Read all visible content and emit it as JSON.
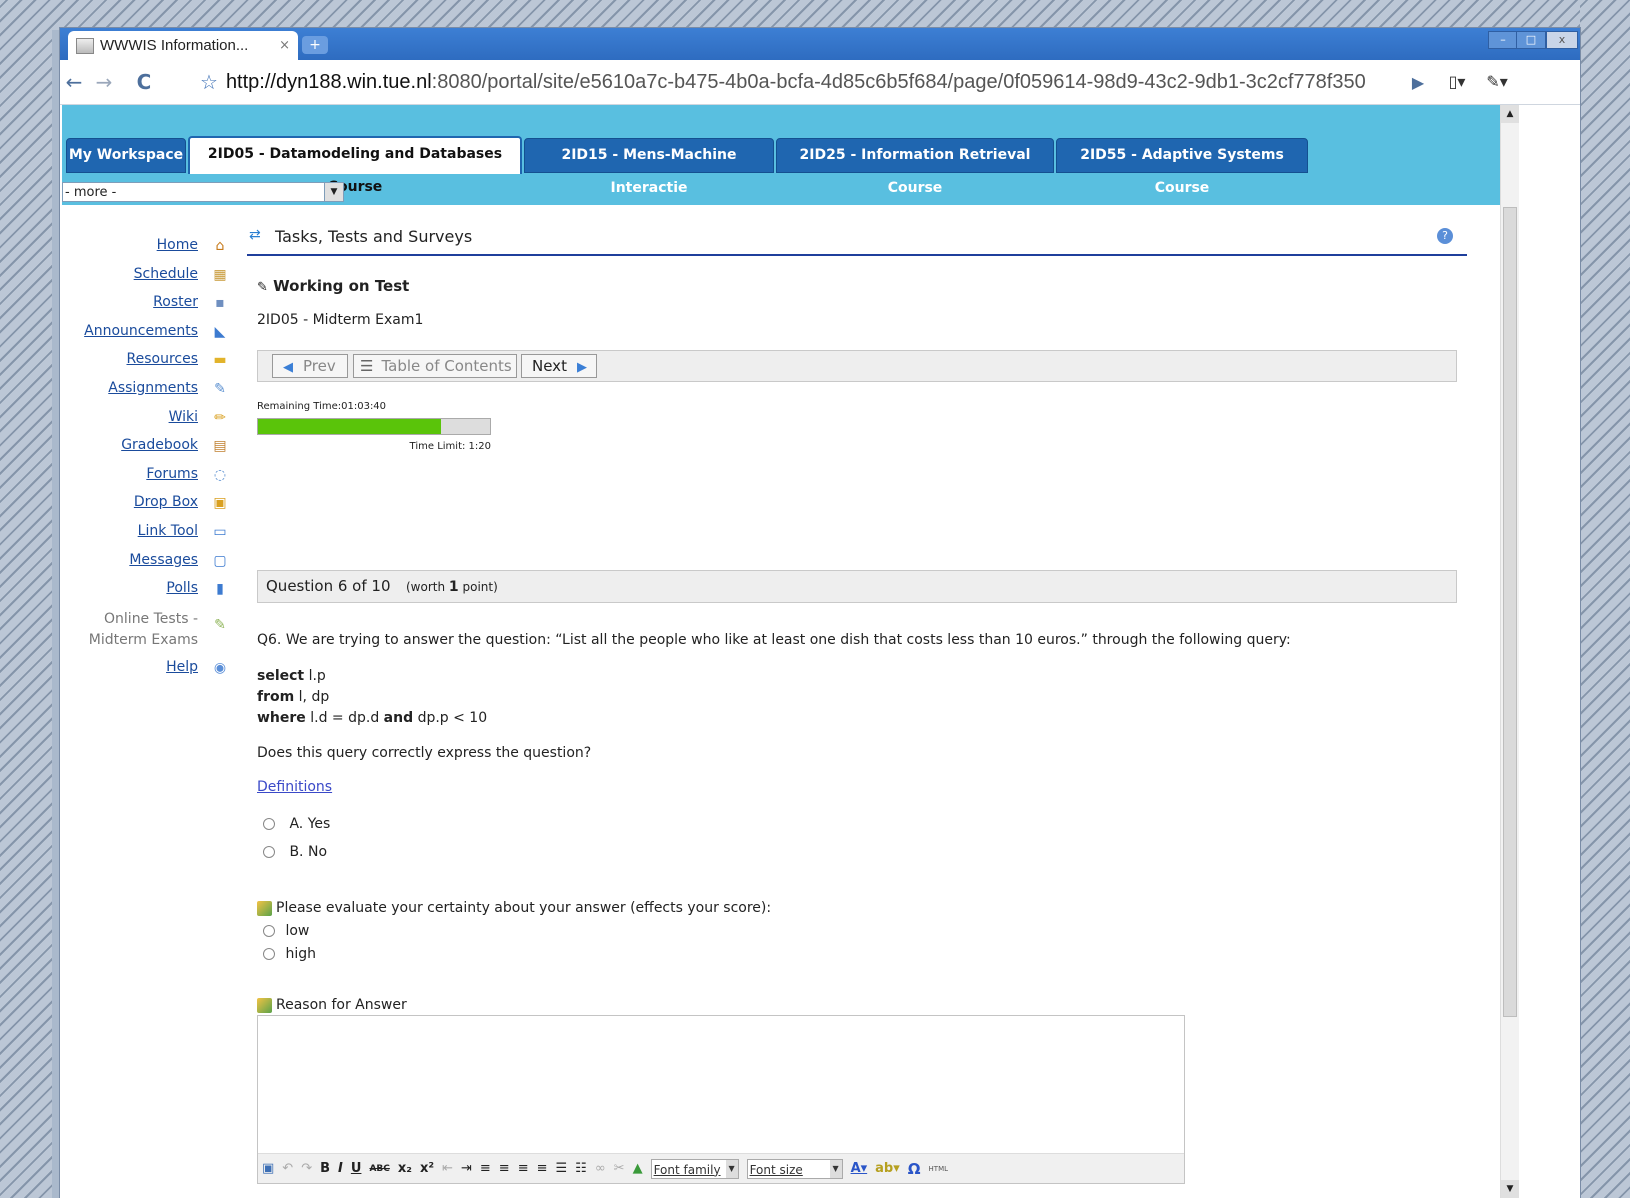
{
  "browser": {
    "tab_title": "WWWIS Information...",
    "tab_close": "×",
    "new_tab": "+",
    "url_host": "http://dyn188.win.tue.nl",
    "url_path": ":8080/portal/site/e5610a7c-b475-4b0a-bcfa-4d85c6b5f684/page/0f059614-98d9-43c2-9db1-3c2cf778f350",
    "back": "←",
    "forward": "→",
    "reload": "C",
    "star": "☆",
    "go": "▶",
    "page_menu": "▯▾",
    "wrench_menu": "✎▾"
  },
  "site_tabs": [
    {
      "label": "My Workspace"
    },
    {
      "label": "2ID05 - Datamodeling and Databases Course"
    },
    {
      "label": "2ID15 - Mens-Machine Interactie"
    },
    {
      "label": "2ID25 - Information Retrieval Course"
    },
    {
      "label": "2ID55 - Adaptive Systems Course"
    }
  ],
  "more_select": "- more -",
  "tool_menu": [
    {
      "label": "Home",
      "icon": "house-icon"
    },
    {
      "label": "Schedule",
      "icon": "calendar-icon"
    },
    {
      "label": "Roster",
      "icon": "roster-icon"
    },
    {
      "label": "Announcements",
      "icon": "megaphone-icon"
    },
    {
      "label": "Resources",
      "icon": "folder-icon"
    },
    {
      "label": "Assignments",
      "icon": "assignment-icon"
    },
    {
      "label": "Wiki",
      "icon": "pencil-icon"
    },
    {
      "label": "Gradebook",
      "icon": "gradebook-icon"
    },
    {
      "label": "Forums",
      "icon": "forum-bubbles-icon"
    },
    {
      "label": "Drop Box",
      "icon": "dropbox-icon"
    },
    {
      "label": "Link Tool",
      "icon": "window-icon"
    },
    {
      "label": "Messages",
      "icon": "message-icon"
    },
    {
      "label": "Polls",
      "icon": "bar-chart-icon"
    }
  ],
  "current_tool": {
    "line1": "Online Tests -",
    "line2": "Midterm Exams"
  },
  "help_link": "Help",
  "page": {
    "title": "Tasks, Tests and Surveys",
    "help_icon": "?",
    "subtitle": "Working on Test",
    "test_name": "2ID05 - Midterm Exam1"
  },
  "nav": {
    "prev": "Prev",
    "toc": "Table of Contents",
    "next": "Next"
  },
  "timer": {
    "remaining": "Remaining Time:01:03:40",
    "limit": "Time Limit: 1:20",
    "progress_percent": 79,
    "bar_color": "#5ac40a"
  },
  "question": {
    "header": "Question 6 of 10",
    "worth_prefix": "(worth",
    "worth_value": "1",
    "worth_suffix": "point)",
    "text": "Q6. We are trying to answer the question: “List all the people who like at least one dish that costs less than 10 euros.” through the following query:",
    "query_select_kw": "select",
    "query_select": "l.p",
    "query_from_kw": "from",
    "query_from": "l, dp",
    "query_where_kw": "where",
    "query_where_1": "l.d = dp.d",
    "query_and_kw": "and",
    "query_where_2": "dp.p < 10",
    "prompt": "Does this query correctly express the question?",
    "definitions_link": "Definitions",
    "options": [
      {
        "letter": "A.",
        "label": "Yes"
      },
      {
        "letter": "B.",
        "label": "No"
      }
    ]
  },
  "certainty": {
    "label": "Please evaluate your certainty about your answer (effects your score):",
    "options": [
      "low",
      "high"
    ]
  },
  "reason": {
    "label": "Reason for Answer",
    "font_family": "Font family",
    "font_size": "Font size",
    "html": "HTML"
  }
}
